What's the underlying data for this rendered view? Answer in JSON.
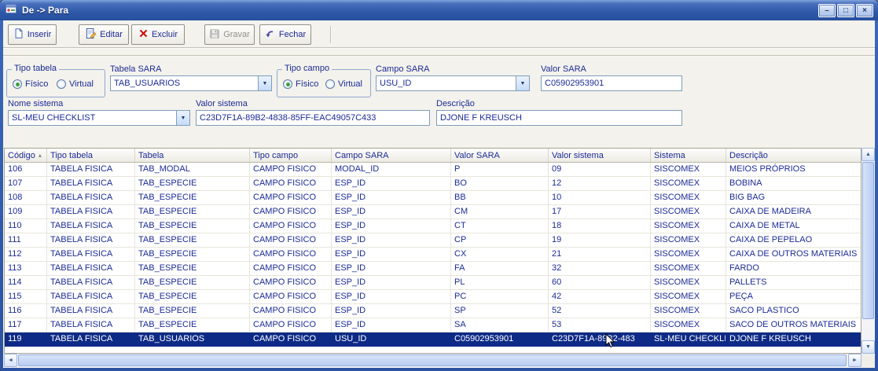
{
  "window": {
    "title": "De -> Para",
    "controls": {
      "minimize": "–",
      "maximize": "□",
      "close": "×"
    }
  },
  "toolbar": {
    "buttons": [
      {
        "label": "Inserir",
        "enabled": true
      },
      {
        "label": "Editar",
        "enabled": true
      },
      {
        "label": "Excluir",
        "enabled": true
      },
      {
        "label": "Gravar",
        "enabled": false
      },
      {
        "label": "Fechar",
        "enabled": true
      }
    ]
  },
  "form": {
    "tipo_tabela": {
      "label": "Tipo tabela",
      "options": [
        "Físico",
        "Virtual"
      ],
      "selected": "Físico"
    },
    "tabela_sara": {
      "label": "Tabela SARA",
      "value": "TAB_USUARIOS"
    },
    "tipo_campo": {
      "label": "Tipo campo",
      "options": [
        "Físico",
        "Virtual"
      ],
      "selected": "Físico"
    },
    "campo_sara": {
      "label": "Campo SARA",
      "value": "USU_ID"
    },
    "valor_sara": {
      "label": "Valor SARA",
      "value": "C05902953901"
    },
    "nome_sistema": {
      "label": "Nome sistema",
      "value": "SL-MEU CHECKLIST"
    },
    "valor_sistema": {
      "label": "Valor sistema",
      "value": "C23D7F1A-89B2-4838-85FF-EAC49057C433"
    },
    "descricao": {
      "label": "Descrição",
      "value": "DJONE F KREUSCH"
    }
  },
  "grid": {
    "columns": [
      "Código",
      "Tipo tabela",
      "Tabela",
      "Tipo campo",
      "Campo SARA",
      "Valor SARA",
      "Valor sistema",
      "Sistema",
      "Descrição"
    ],
    "sort": {
      "column_index": 0,
      "direction": "asc"
    },
    "selected_row_index": 12,
    "rows": [
      [
        "106",
        "TABELA FISICA",
        "TAB_MODAL",
        "CAMPO FISICO",
        "MODAL_ID",
        "P",
        "09",
        "SISCOMEX",
        "MEIOS PRÓPRIOS"
      ],
      [
        "107",
        "TABELA FISICA",
        "TAB_ESPECIE",
        "CAMPO FISICO",
        "ESP_ID",
        "BO",
        "12",
        "SISCOMEX",
        "BOBINA"
      ],
      [
        "108",
        "TABELA FISICA",
        "TAB_ESPECIE",
        "CAMPO FISICO",
        "ESP_ID",
        "BB",
        "10",
        "SISCOMEX",
        "BIG BAG"
      ],
      [
        "109",
        "TABELA FISICA",
        "TAB_ESPECIE",
        "CAMPO FISICO",
        "ESP_ID",
        "CM",
        "17",
        "SISCOMEX",
        "CAIXA DE MADEIRA"
      ],
      [
        "110",
        "TABELA FISICA",
        "TAB_ESPECIE",
        "CAMPO FISICO",
        "ESP_ID",
        "CT",
        "18",
        "SISCOMEX",
        "CAIXA DE METAL"
      ],
      [
        "111",
        "TABELA FISICA",
        "TAB_ESPECIE",
        "CAMPO FISICO",
        "ESP_ID",
        "CP",
        "19",
        "SISCOMEX",
        "CAIXA DE PEPELAO"
      ],
      [
        "112",
        "TABELA FISICA",
        "TAB_ESPECIE",
        "CAMPO FISICO",
        "ESP_ID",
        "CX",
        "21",
        "SISCOMEX",
        "CAIXA DE OUTROS MATERIAIS"
      ],
      [
        "113",
        "TABELA FISICA",
        "TAB_ESPECIE",
        "CAMPO FISICO",
        "ESP_ID",
        "FA",
        "32",
        "SISCOMEX",
        "FARDO"
      ],
      [
        "114",
        "TABELA FISICA",
        "TAB_ESPECIE",
        "CAMPO FISICO",
        "ESP_ID",
        "PL",
        "60",
        "SISCOMEX",
        "PALLETS"
      ],
      [
        "115",
        "TABELA FISICA",
        "TAB_ESPECIE",
        "CAMPO FISICO",
        "ESP_ID",
        "PC",
        "42",
        "SISCOMEX",
        "PEÇA"
      ],
      [
        "116",
        "TABELA FISICA",
        "TAB_ESPECIE",
        "CAMPO FISICO",
        "ESP_ID",
        "SP",
        "52",
        "SISCOMEX",
        "SACO PLASTICO"
      ],
      [
        "117",
        "TABELA FISICA",
        "TAB_ESPECIE",
        "CAMPO FISICO",
        "ESP_ID",
        "SA",
        "53",
        "SISCOMEX",
        "SACO DE OUTROS MATERIAIS"
      ],
      [
        "119",
        "TABELA FISICA",
        "TAB_USUARIOS",
        "CAMPO FISICO",
        "USU_ID",
        "C05902953901",
        "C23D7F1A-89B2-483",
        "SL-MEU CHECKLIST",
        "DJONE F KREUSCH"
      ]
    ]
  },
  "icons": {
    "dropdown_arrow": "▼",
    "sort_asc": "▴",
    "scroll_up": "▲",
    "scroll_down": "▼",
    "scroll_left": "◄",
    "scroll_right": "►"
  },
  "colors": {
    "titlebar_blue": "#2F58A8",
    "navy_text": "#1B2B96",
    "selected_row_bg": "#0D2A86",
    "selected_row_text": "#FFFFFF",
    "delete_red": "#CC0A0A"
  }
}
